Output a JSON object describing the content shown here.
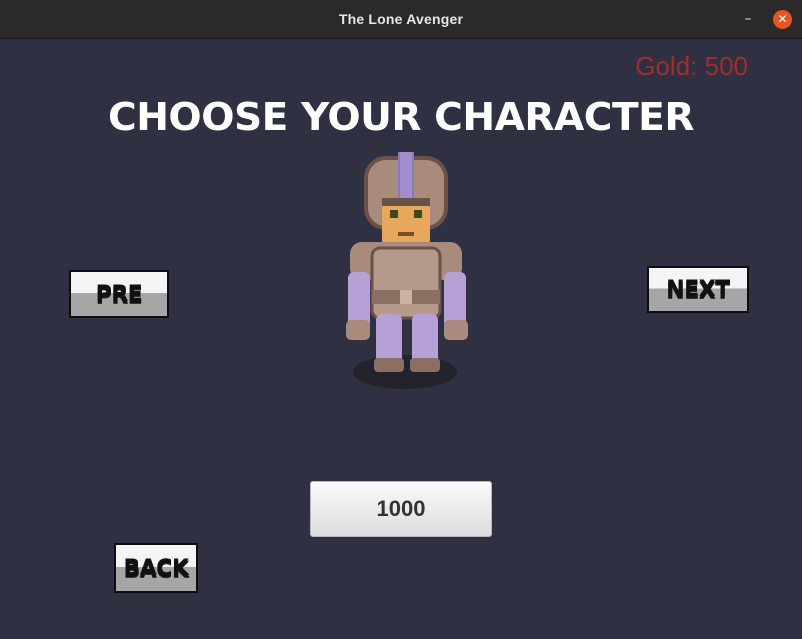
{
  "window": {
    "title": "The Lone Avenger",
    "minimize_glyph": "–",
    "close_glyph": "✕"
  },
  "hud": {
    "gold_label": "Gold: 500"
  },
  "screen": {
    "heading": "CHOOSE YOUR CHARACTER",
    "character_sprite": "armored-knight-sprite",
    "prev_label": "PRE",
    "next_label": "NEXT",
    "price_label": "1000",
    "back_label": "BACK"
  },
  "colors": {
    "background": "#2f3142",
    "gold_text": "#a32c2c",
    "close_button": "#e95420"
  }
}
